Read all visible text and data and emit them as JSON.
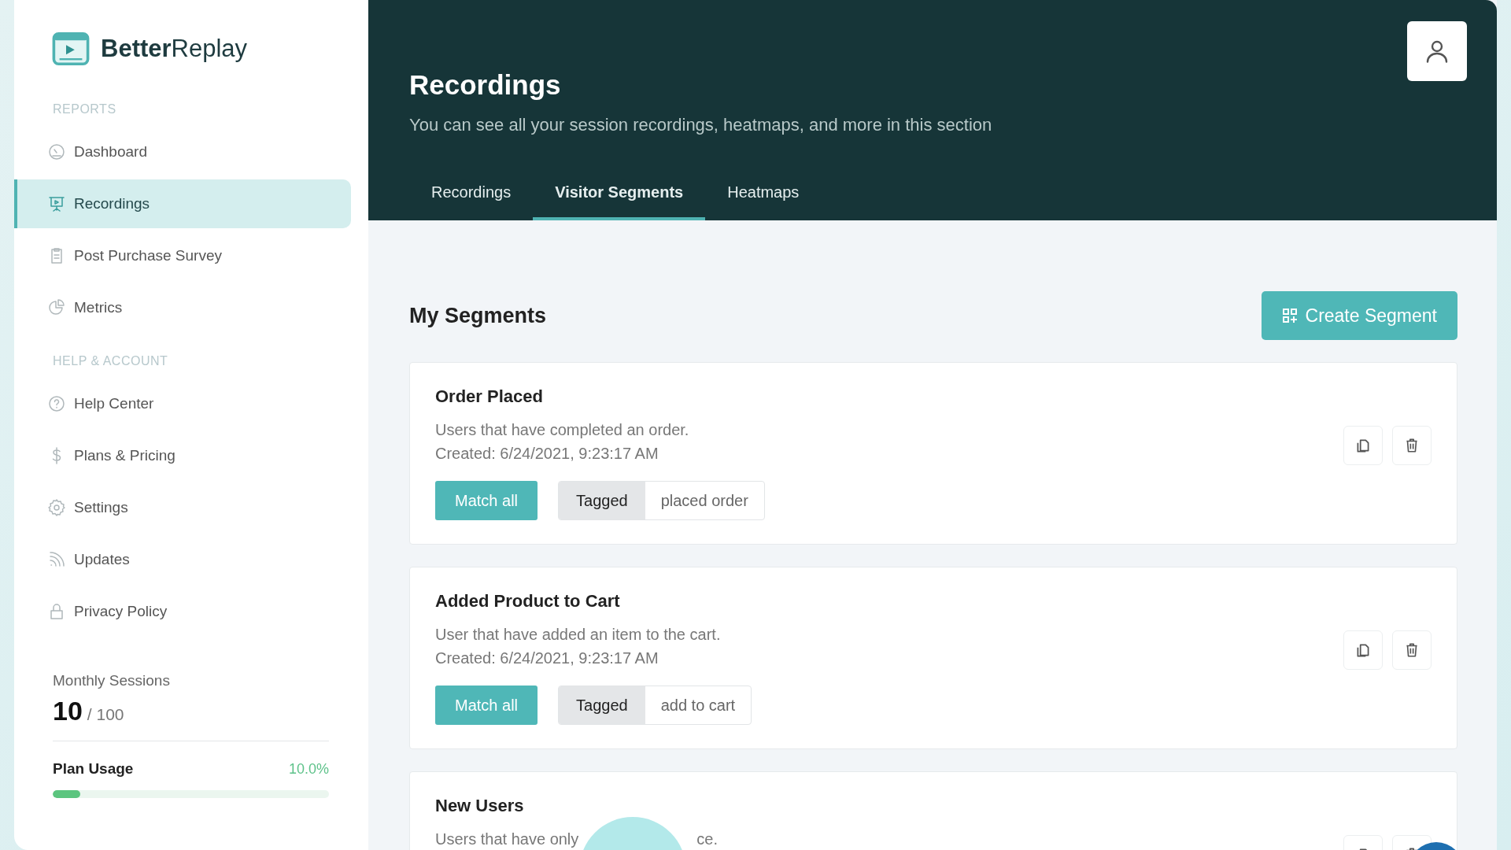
{
  "brand": {
    "bold": "Better",
    "light": "Replay"
  },
  "sidebar": {
    "groups": [
      {
        "heading": "REPORTS",
        "items": [
          {
            "label": "Dashboard",
            "selected": false
          },
          {
            "label": "Recordings",
            "selected": true
          },
          {
            "label": "Post Purchase Survey",
            "selected": false
          },
          {
            "label": "Metrics",
            "selected": false
          }
        ]
      },
      {
        "heading": "HELP & ACCOUNT",
        "items": [
          {
            "label": "Help Center",
            "selected": false
          },
          {
            "label": "Plans & Pricing",
            "selected": false
          },
          {
            "label": "Settings",
            "selected": false
          },
          {
            "label": "Updates",
            "selected": false
          },
          {
            "label": "Privacy Policy",
            "selected": false
          }
        ]
      }
    ]
  },
  "usage": {
    "label": "Monthly Sessions",
    "count": "10",
    "limit": "/ 100",
    "plan_label": "Plan Usage",
    "percent": "10.0%",
    "level": 0.1
  },
  "header": {
    "title": "Recordings",
    "subtitle": "You can see all your session recordings, heatmaps, and more in this section"
  },
  "tabs": [
    {
      "label": "Recordings",
      "selected": false
    },
    {
      "label": "Visitor Segments",
      "selected": true
    },
    {
      "label": "Heatmaps",
      "selected": false
    }
  ],
  "section": {
    "title": "My Segments",
    "button": "Create Segment"
  },
  "segments": [
    {
      "title": "Order Placed",
      "description": "Users that have completed an order.",
      "created": "Created: 6/24/2021, 9:23:17 AM",
      "match": "Match all",
      "tag": "Tagged",
      "value": "placed order"
    },
    {
      "title": "Added Product to Cart",
      "description": "User that have added an item to the cart.",
      "created": "Created: 6/24/2021, 9:23:17 AM",
      "match": "Match all",
      "tag": "Tagged",
      "value": "add to cart"
    },
    {
      "title": "New Users",
      "description": "Users that have only",
      "description_end": "ce."
    }
  ]
}
